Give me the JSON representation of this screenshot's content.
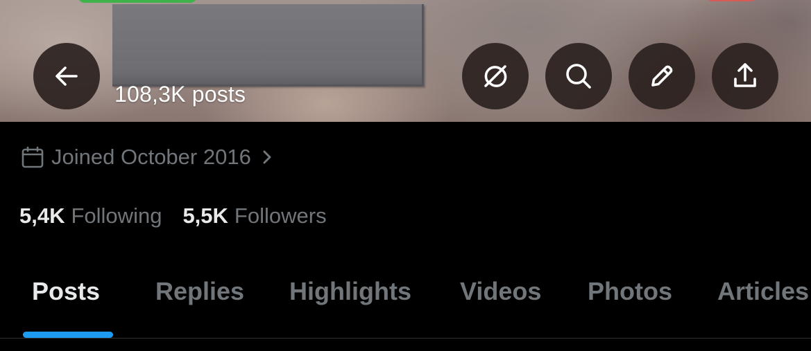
{
  "header": {
    "posts_count": "108,3K posts",
    "buttons": {
      "back": {
        "icon": "arrow-left-icon"
      },
      "grok": {
        "icon": "grok-icon"
      },
      "search": {
        "icon": "search-icon"
      },
      "edit": {
        "icon": "pencil-icon"
      },
      "share": {
        "icon": "share-icon"
      }
    }
  },
  "profile": {
    "joined": "Joined October 2016",
    "following_count": "5,4K",
    "following_label": "Following",
    "followers_count": "5,5K",
    "followers_label": "Followers"
  },
  "tabs": [
    {
      "label": "Posts",
      "active": true
    },
    {
      "label": "Replies",
      "active": false
    },
    {
      "label": "Highlights",
      "active": false
    },
    {
      "label": "Videos",
      "active": false
    },
    {
      "label": "Photos",
      "active": false
    },
    {
      "label": "Articles",
      "active": false
    }
  ],
  "colors": {
    "accent": "#1d9bf0",
    "background": "#000000",
    "primary_text": "#e7e9ea",
    "secondary_text": "#71767b"
  }
}
